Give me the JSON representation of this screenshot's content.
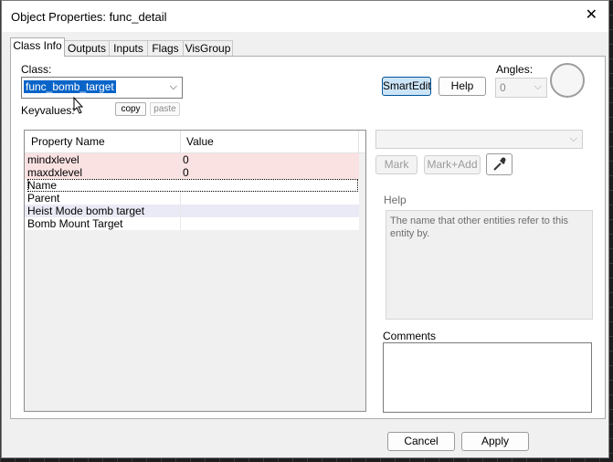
{
  "window": {
    "title": "Object Properties: func_detail"
  },
  "tabs": [
    {
      "label": "Class Info",
      "active": true
    },
    {
      "label": "Outputs"
    },
    {
      "label": "Inputs"
    },
    {
      "label": "Flags"
    },
    {
      "label": "VisGroup"
    }
  ],
  "classinfo": {
    "class_label": "Class:",
    "class_value": "func_bomb_target",
    "keyvalues_label": "Keyvalues:",
    "copy_label": "copy",
    "paste_label": "paste",
    "smartedit_label": "SmartEdit",
    "help_label": "Help",
    "angles_label": "Angles:",
    "angles_value": "0"
  },
  "table": {
    "headers": [
      "Property Name",
      "Value"
    ],
    "rows": [
      {
        "name": "mindxlevel",
        "value": "0"
      },
      {
        "name": "maxdxlevel",
        "value": "0"
      },
      {
        "name": "Name",
        "value": ""
      },
      {
        "name": "Parent",
        "value": ""
      },
      {
        "name": "Heist Mode bomb target",
        "value": ""
      },
      {
        "name": "Bomb Mount Target",
        "value": ""
      }
    ]
  },
  "right": {
    "value_combo": "",
    "mark_label": "Mark",
    "markadd_label": "Mark+Add",
    "help_heading": "Help",
    "help_text": "The name that other entities refer to this entity by.",
    "comments_label": "Comments",
    "comments_value": ""
  },
  "footer": {
    "cancel_label": "Cancel",
    "apply_label": "Apply"
  },
  "colors": {
    "selection": "#0a64c8",
    "focus_button": "#cce4f7",
    "row_pink": "#fbe2e2",
    "row_lavender": "#eaeaf6"
  }
}
